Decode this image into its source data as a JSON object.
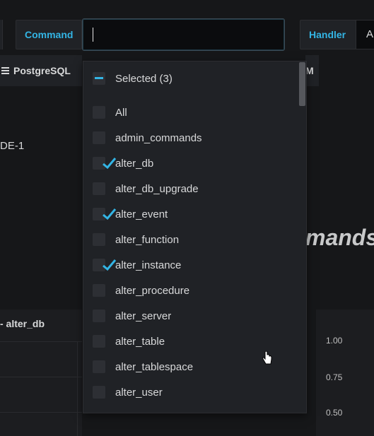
{
  "topbar": {
    "command_label": "Command",
    "command_value": "",
    "handler_label": "Handler",
    "handler_value": "A"
  },
  "dashboard": {
    "datasource_button": "PostgreSQL",
    "right_button": "M",
    "node_label": "DE-1",
    "big_title": "mands",
    "panel_left_title": "- alter_db",
    "y_ticks": [
      "1.00",
      "0.75",
      "0.50"
    ]
  },
  "dropdown": {
    "selected_label": "Selected (3)",
    "items": [
      {
        "label": "All",
        "checked": false
      },
      {
        "label": "admin_commands",
        "checked": false
      },
      {
        "label": "alter_db",
        "checked": true
      },
      {
        "label": "alter_db_upgrade",
        "checked": false
      },
      {
        "label": "alter_event",
        "checked": true
      },
      {
        "label": "alter_function",
        "checked": false
      },
      {
        "label": "alter_instance",
        "checked": true
      },
      {
        "label": "alter_procedure",
        "checked": false
      },
      {
        "label": "alter_server",
        "checked": false
      },
      {
        "label": "alter_table",
        "checked": false
      },
      {
        "label": "alter_tablespace",
        "checked": false
      },
      {
        "label": "alter_user",
        "checked": false
      }
    ]
  },
  "colors": {
    "accent": "#33b5e5",
    "background": "#161719",
    "panel": "#202226"
  },
  "icons": [
    "menu-icon",
    "checkbox-indeterminate-icon",
    "checkmark-icon",
    "hand-cursor-icon"
  ]
}
